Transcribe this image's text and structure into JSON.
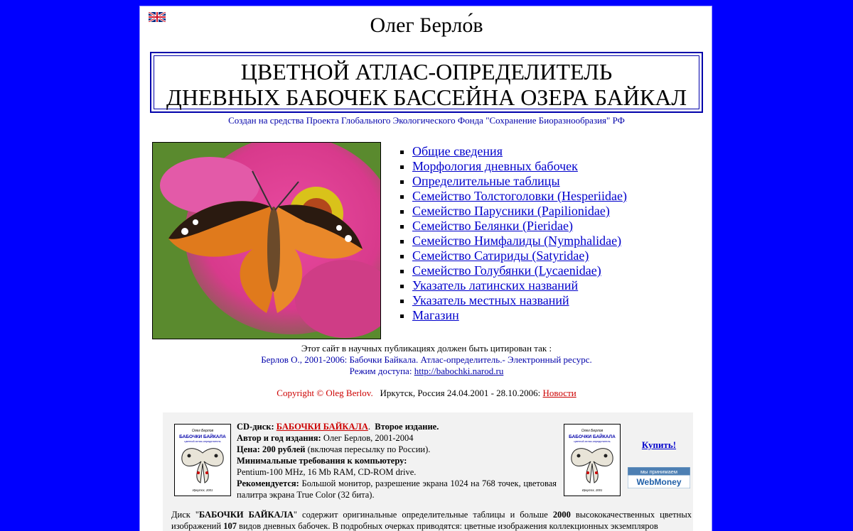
{
  "header": {
    "author": "Олег Берло́в",
    "title_line1": "ЦВЕТНОЙ АТЛАС-ОПРЕДЕЛИТЕЛЬ",
    "title_line2": "ДНЕВНЫХ БАБОЧЕК БАССЕЙНА ОЗЕРА БАЙКАЛ",
    "funded_by": "Создан на средства Проекта Глобального Экологического Фонда \"Сохранение Биоразнообразия\" РФ"
  },
  "nav": {
    "items": [
      "Общие сведения",
      "Морфология дневных бабочек",
      "Определительные таблицы",
      "Семейство Толстоголовки (Hesperiidae)",
      "Семейство Парусники (Papilionidae)",
      "Семейство Белянки (Pieridae)",
      "Семейство Нимфалиды (Nymphalidae)",
      "Семейство Сатириды (Satyridae)",
      "Семейство Голубянки (Lycaenidae)",
      "Указатель латинских названий",
      "Указатель местных названий",
      "Магазин"
    ]
  },
  "citation": {
    "line1": "Этот сайт в научных публикациях должен быть цитирован так :",
    "line2": "Берлов О., 2001-2006: Бабочки Байкала. Атлас-определитель.- Электронный ресурс.",
    "line3_prefix": "Режим доступа: ",
    "url": "http://babochki.narod.ru"
  },
  "footer": {
    "copyright": "Copyright © Oleg Berlov.",
    "place_dates": "Иркутск, Россия 24.04.2001 - 28.10.2006:",
    "news_link": "Новости"
  },
  "shop": {
    "cd_label": "CD-диск:",
    "cd_title": "БАБОЧКИ БАЙКАЛА",
    "edition": "Второе издание.",
    "author_label": "Автор и год издания:",
    "author_value": "Олег Берлов, 2001-2004",
    "price_label": "Цена:",
    "price_value": "200 рублей",
    "price_note": "(включая пересылку по России).",
    "req_label": "Минимальные требования к компьютеру:",
    "req_value": "Pentium-100 MHz, 16 Mb RAM, CD-ROM drive.",
    "rec_label": "Рекомендуется:",
    "rec_value": "Большой монитор, разрешение экрана 1024 на 768 точек, цветовая палитра экрана True Color (32 бита).",
    "buy_link": "Купить!",
    "webmoney_top": "мы принимаем",
    "webmoney_brand": "WebMoney",
    "cover_author": "Олег Берлов",
    "cover_title": "БАБОЧКИ БАЙКАЛА",
    "cover_subtitle": "цветной атлас-определитель",
    "cover_city": "Иркутск, 2001",
    "desc_prefix": "Диск \"",
    "desc_title": "БАБОЧКИ БАЙКАЛА",
    "desc_mid": "\" содержит оригинальные определительные таблицы и больше ",
    "desc_count": "2000",
    "desc_mid2": " высококачественных цветных изображений ",
    "desc_species": "107",
    "desc_rest": " видов дневных бабочек. В подробных очерках приводятся: цветные изображения коллекционных экземпляров"
  },
  "colors": {
    "background": "#0000ff",
    "link": "#0000cc",
    "red": "#cc0000",
    "title_border": "#0000aa"
  }
}
